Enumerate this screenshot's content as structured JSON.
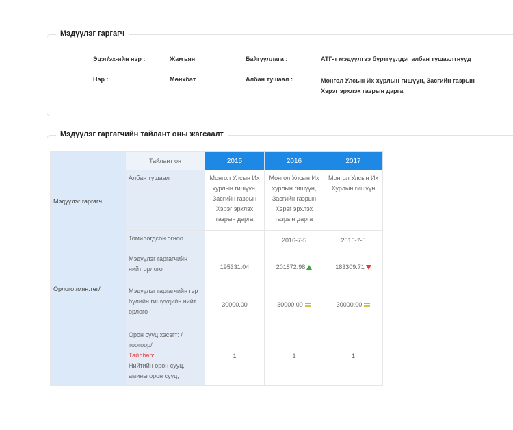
{
  "declarant": {
    "title": "Мэдүүлэг гаргагч",
    "father_label": "Эцэг/эх-ийн нэр :",
    "father_value": "Жамъян",
    "name_label": "Нэр :",
    "name_value": "Мөнхбат",
    "org_label": "Байгууллага :",
    "org_value": "АТГ-т мэдүүлгээ бүртгүүлдэг албан тушаалтнууд",
    "position_label": "Албан тушаал :",
    "position_value": "Монгол Улсын Их хурлын гишүүн, Засгийн газрын Хэрэг эрхлэх газрын дарга"
  },
  "report": {
    "title": "Мэдүүлэг гаргагчийн тайлант оны жагсаалт",
    "year_header": "Тайлант он",
    "years": [
      "2015",
      "2016",
      "2017"
    ],
    "declarant_label": "Мэдүүлэг гаргагч",
    "position_row_label": "Албан тушаал",
    "positions": [
      "Монгол Улсын Их хурлын гишүүн, Засгийн газрын Хэрэг эрхлэх газрын дарга",
      "Монгол Улсын Их хурлын гишүүн, Засгийн газрын Хэрэг эрхлэх газрын дарга",
      "Монгол Улсын Их Хурлын гишүүн"
    ],
    "appointed_label": "Томилогдсон огноо",
    "appointed": [
      "",
      "2016-7-5",
      "2016-7-5"
    ],
    "income_label": "Орлого /мян.төг/",
    "total_income_label": "Мэдүүлэг гаргагчийн нийт орлого",
    "total_income": [
      "195331.04",
      "201872.98",
      "183309.71"
    ],
    "total_income_trend": [
      "none",
      "up",
      "down"
    ],
    "family_income_label": "Мэдүүлэг гаргагчийн гэр бүлийн гишүүдийн нийт орлого",
    "family_income": [
      "30000.00",
      "30000.00",
      "30000.00"
    ],
    "housing_label": "Орон сууц хэсэгт: /тоогоор/",
    "note_label": "Тайлбар:",
    "housing_desc": "Нийтийн орон сууц, амины орон сууц, зуслангийн барилга, зуслангийн",
    "housing": [
      "1",
      "1",
      "1"
    ]
  },
  "colors": {
    "header_blue": "#1e88e5",
    "category_bg": "#dbe9f9",
    "trend_up": "#43a047",
    "trend_down": "#e53935"
  }
}
